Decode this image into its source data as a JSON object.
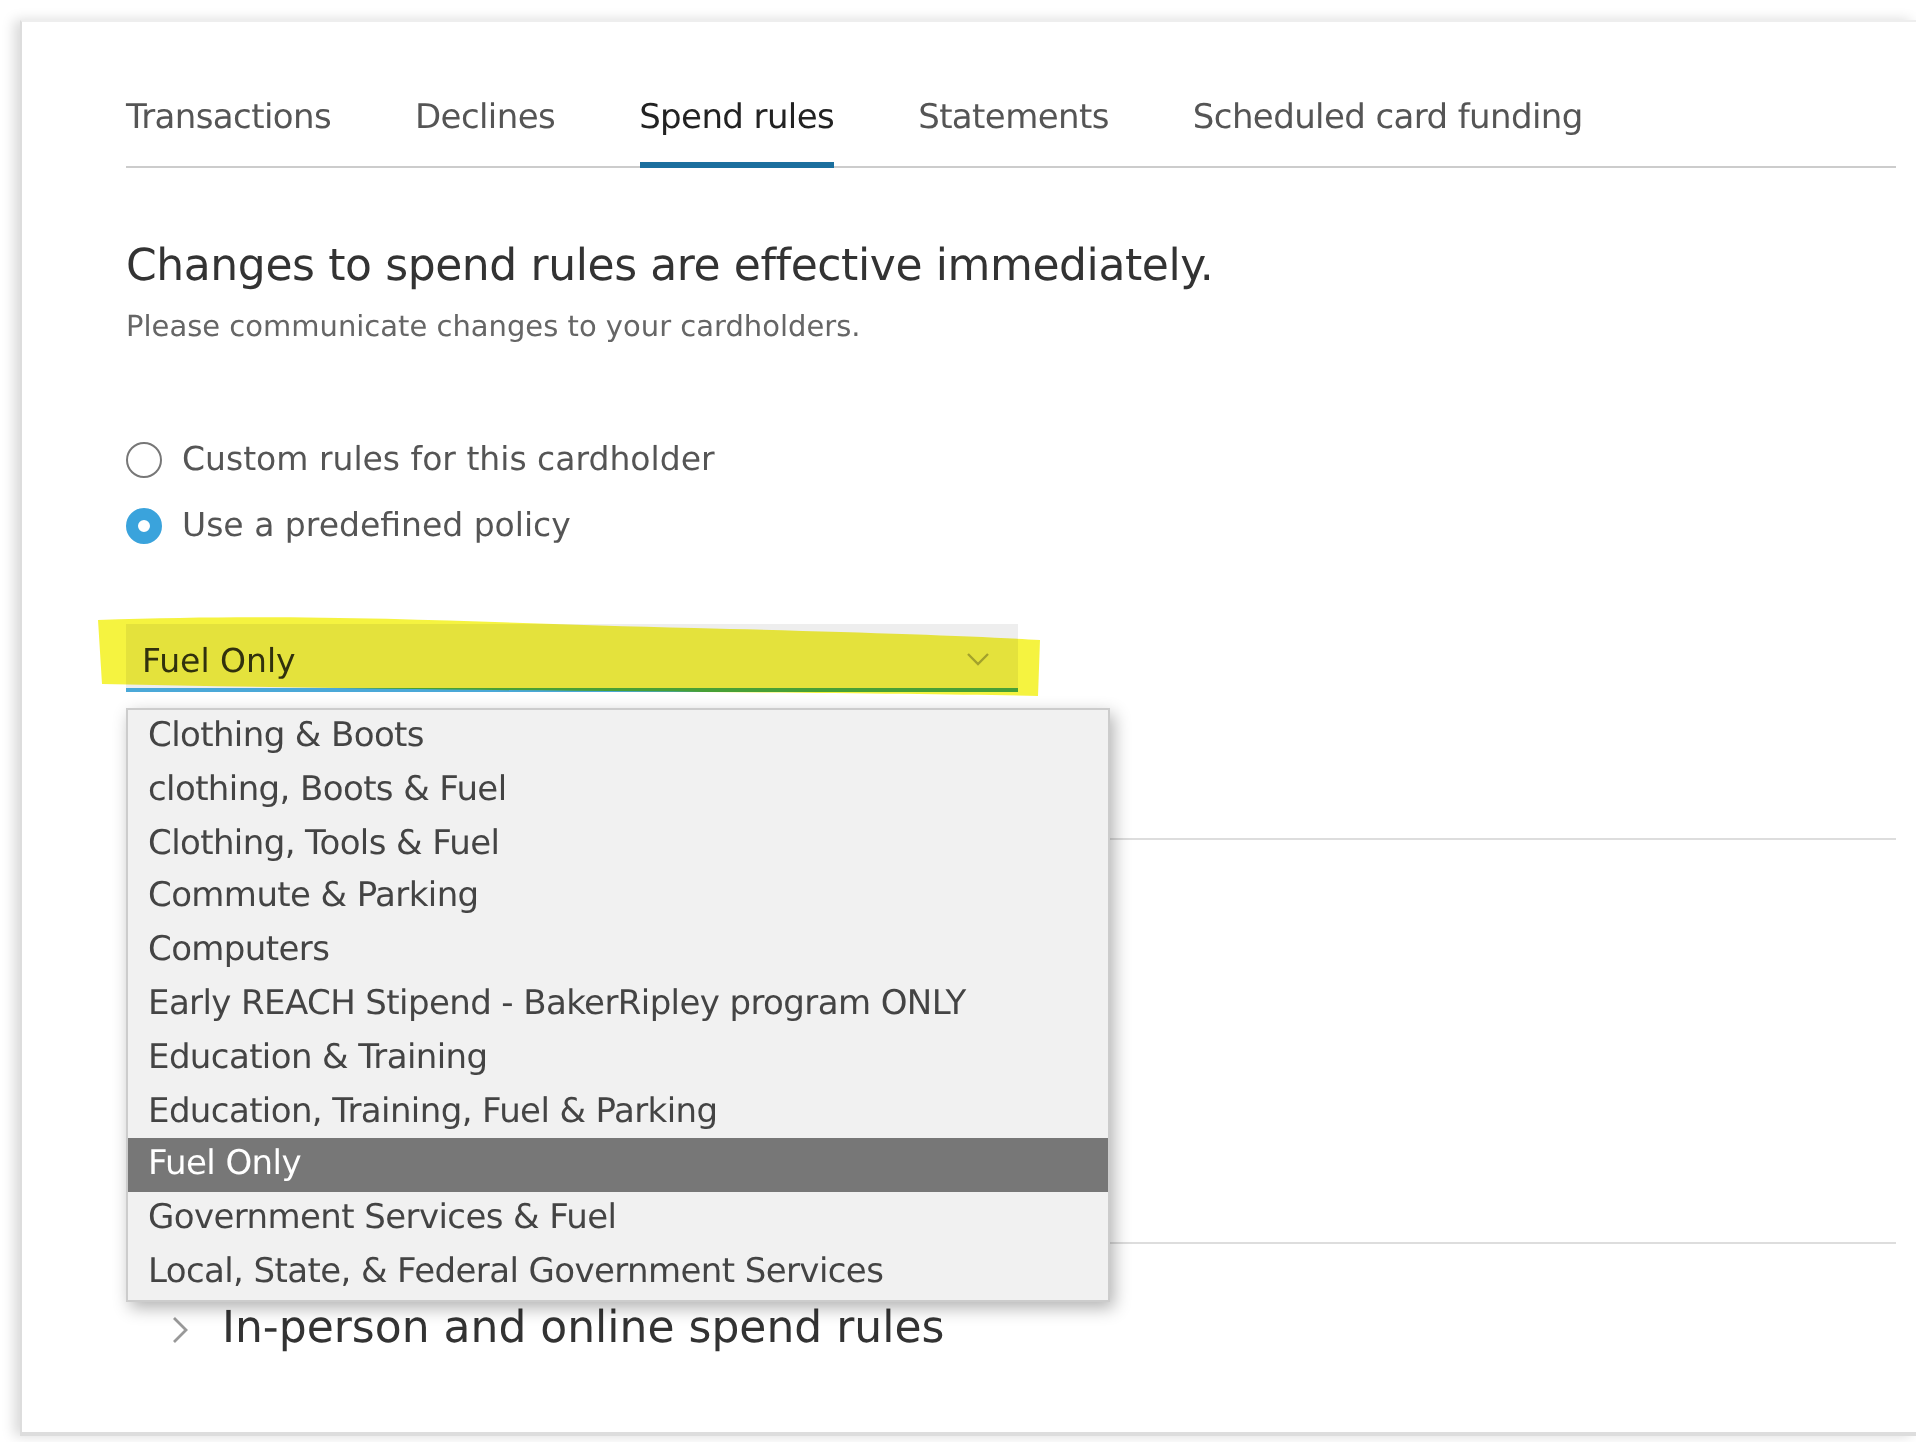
{
  "tabs": [
    {
      "label": "Transactions",
      "selected": false
    },
    {
      "label": "Declines",
      "selected": false
    },
    {
      "label": "Spend rules",
      "selected": true
    },
    {
      "label": "Statements",
      "selected": false
    },
    {
      "label": "Scheduled card funding",
      "selected": false
    }
  ],
  "heading": "Changes to spend rules are effective immediately.",
  "subheading": "Please communicate changes to your cardholders.",
  "options": [
    {
      "label": "Custom rules for this cardholder",
      "selected": false
    },
    {
      "label": "Use a predefined policy",
      "selected": true
    }
  ],
  "policy_select": {
    "value": "Fuel Only",
    "expanded": true,
    "highlighted": true
  },
  "policy_list": [
    {
      "label": "Clothing & Boots",
      "selected": false
    },
    {
      "label": "clothing, Boots & Fuel",
      "selected": false
    },
    {
      "label": "Clothing, Tools & Fuel",
      "selected": false
    },
    {
      "label": "Commute & Parking",
      "selected": false
    },
    {
      "label": "Computers",
      "selected": false
    },
    {
      "label": "Early REACH Stipend - BakerRipley program ONLY",
      "selected": false
    },
    {
      "label": "Education & Training",
      "selected": false
    },
    {
      "label": "Education, Training, Fuel & Parking",
      "selected": false
    },
    {
      "label": "Fuel Only",
      "selected": true
    },
    {
      "label": "Government Services & Fuel",
      "selected": false
    },
    {
      "label": "Local, State, & Federal Government Services",
      "selected": false
    }
  ],
  "section": {
    "title": "In-person and online spend rules",
    "expanded": false
  }
}
